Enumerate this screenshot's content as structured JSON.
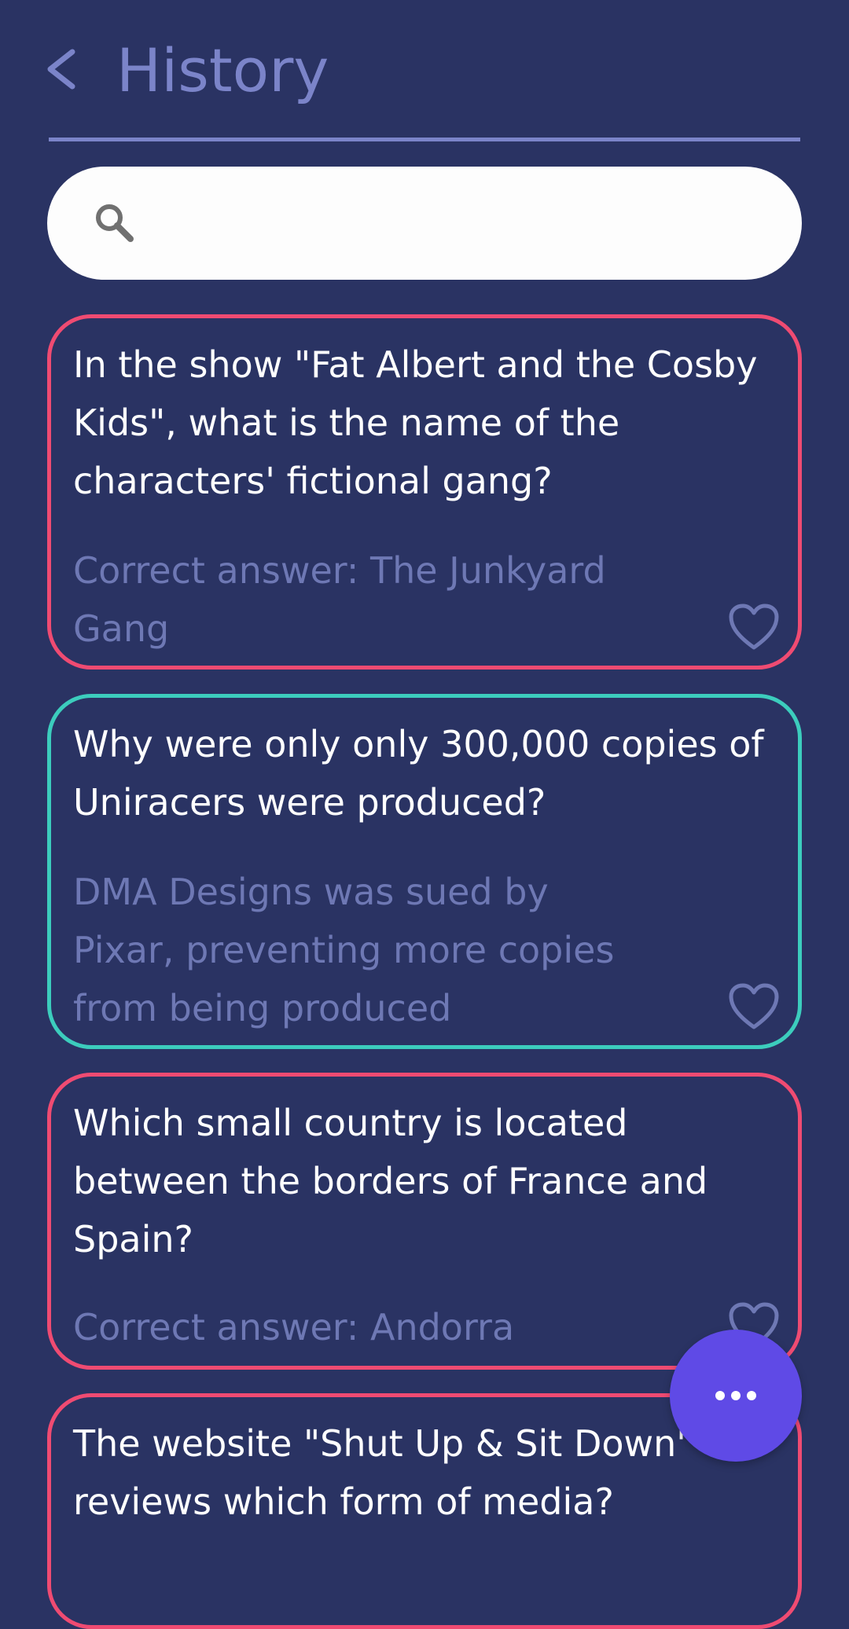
{
  "header": {
    "title": "History"
  },
  "search": {
    "placeholder": "",
    "value": ""
  },
  "cards": [
    {
      "question": "In the show \"Fat Albert and the Cosby Kids\", what is the name of the characters' fictional gang?",
      "answer": "Correct answer: The Junkyard Gang",
      "status": "incorrect"
    },
    {
      "question": "Why were only only 300,000 copies of Uniracers were produced?",
      "answer": "DMA Designs was sued by Pixar, preventing more copies from being produced",
      "status": "correct"
    },
    {
      "question": "Which small country is located between the borders of France and Spain?",
      "answer": "Correct answer: Andorra",
      "status": "incorrect"
    },
    {
      "question": "The website \"Shut Up & Sit Down\" reviews which form of media?",
      "answer": "",
      "status": "incorrect"
    }
  ],
  "colors": {
    "background": "#2a3363",
    "accent": "#7b84c9",
    "incorrect_border": "#ef4b72",
    "correct_border": "#3ccdbd",
    "fab": "#5f4ae6"
  },
  "icons": {
    "back": "chevron-left-icon",
    "search": "search-icon",
    "favorite": "heart-outline-icon",
    "more": "more-horizontal-icon"
  }
}
